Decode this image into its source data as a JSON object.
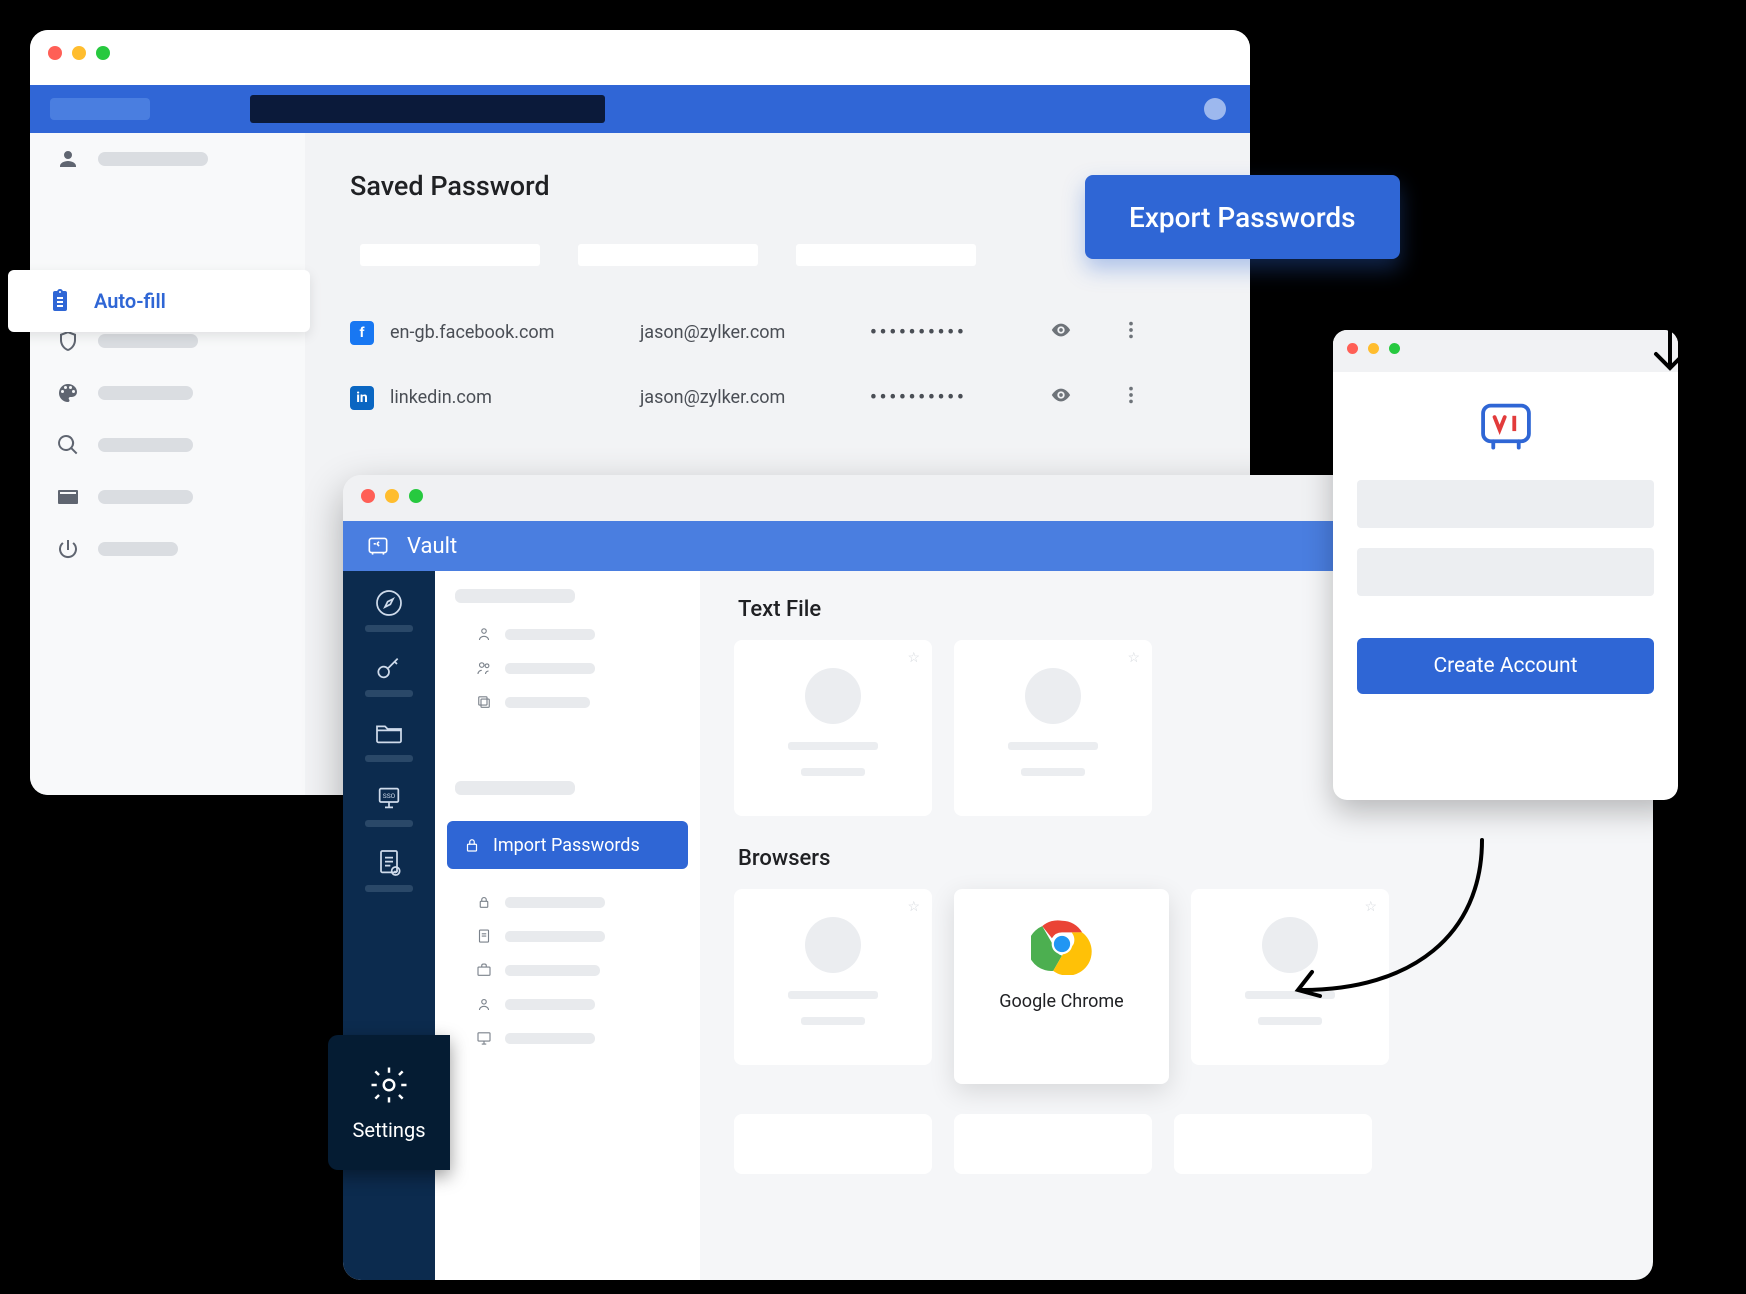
{
  "win1": {
    "sidebar": {
      "autofill_label": "Auto-fill"
    },
    "heading": "Saved Password",
    "rows": [
      {
        "icon": "facebook",
        "site": "en-gb.facebook.com",
        "user": "jason@zylker.com",
        "pwd": "••••••••••"
      },
      {
        "icon": "linkedin",
        "site": "linkedin.com",
        "user": "jason@zylker.com",
        "pwd": "••••••••••"
      }
    ]
  },
  "export_label": "Export Passwords",
  "win2": {
    "title": "Vault",
    "import_label": "Import Passwords",
    "section1": "Text File",
    "section2": "Browsers",
    "chrome_label": "Google Chrome",
    "settings_label": "Settings"
  },
  "win3": {
    "create_label": "Create Account"
  }
}
